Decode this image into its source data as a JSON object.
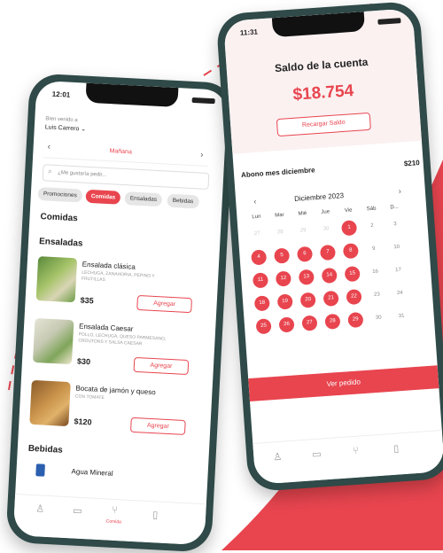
{
  "colors": {
    "accent": "#e8454f",
    "frame": "#2f4a48",
    "background": "#ffffff"
  },
  "phone1": {
    "time": "12:01",
    "user_label": "Bien venido a",
    "user_name": "Luis Carrero",
    "day_nav": {
      "prev": "‹",
      "label": "Mañana",
      "next": "›"
    },
    "search_placeholder": "¿Me gustaría pedir...",
    "chips": [
      "Promociones",
      "Comidas",
      "Ensaladas",
      "Bebidas"
    ],
    "heading": "Comidas",
    "section_salads": "Ensaladas",
    "items": [
      {
        "name": "Ensalada clásica",
        "desc": "LECHUGA, ZANAHORIA, PEPINO Y FRUTILLAS",
        "price": "$35",
        "action": "Agregar"
      },
      {
        "name": "Ensalada Caesar",
        "desc": "POLLO, LECHUGA, QUESO PARMESANO, CROUTONS Y SALSA CAESAR",
        "price": "$30",
        "action": "Agregar"
      },
      {
        "name": "Bocata de jamón y queso",
        "desc": "CON TOMATE",
        "price": "$120",
        "action": "Agregar"
      }
    ],
    "section_drinks": "Bebidas",
    "drink_item": "Agua Mineral",
    "tabs": {
      "user": "user-icon",
      "orders": "calendar-icon",
      "food": "fork-knife-icon",
      "food_label": "Comida",
      "cart": "trash-icon"
    }
  },
  "phone2": {
    "time": "11:31",
    "title": "Saldo de la cuenta",
    "balance": "$18.754",
    "recharge": "Recargar Saldo",
    "subscription_label": "Abono mes diciembre",
    "subscription_amount": "$210",
    "calendar": {
      "month": "Diciembre 2023",
      "prev": "‹",
      "next": "›",
      "weekdays": [
        "Lun",
        "Mar",
        "Mié",
        "Jue",
        "Vie",
        "Sáb",
        "D..."
      ],
      "weeks": [
        [
          "27",
          "28",
          "29",
          "30",
          "1",
          "2",
          "3"
        ],
        [
          "4",
          "5",
          "6",
          "7",
          "8",
          "9",
          "10"
        ],
        [
          "11",
          "12",
          "13",
          "14",
          "15",
          "16",
          "17"
        ],
        [
          "18",
          "19",
          "20",
          "21",
          "22",
          "23",
          "24"
        ],
        [
          "25",
          "26",
          "27",
          "28",
          "29",
          "30",
          "31"
        ]
      ],
      "active_days": [
        [
          0,
          4
        ],
        [
          1,
          0
        ],
        [
          1,
          1
        ],
        [
          1,
          2
        ],
        [
          1,
          3
        ],
        [
          1,
          4
        ],
        [
          2,
          0
        ],
        [
          2,
          1
        ],
        [
          2,
          2
        ],
        [
          2,
          3
        ],
        [
          2,
          4
        ],
        [
          3,
          0
        ],
        [
          3,
          1
        ],
        [
          3,
          2
        ],
        [
          3,
          3
        ],
        [
          3,
          4
        ],
        [
          4,
          0
        ],
        [
          4,
          1
        ],
        [
          4,
          2
        ],
        [
          4,
          3
        ],
        [
          4,
          4
        ]
      ],
      "faded_days": [
        [
          0,
          0
        ],
        [
          0,
          1
        ],
        [
          0,
          2
        ],
        [
          0,
          3
        ]
      ]
    },
    "order_button": "Ver pedido",
    "tabs": {
      "user": "user-icon",
      "orders": "calendar-icon",
      "food": "fork-knife-icon",
      "cart": "trash-icon"
    }
  }
}
